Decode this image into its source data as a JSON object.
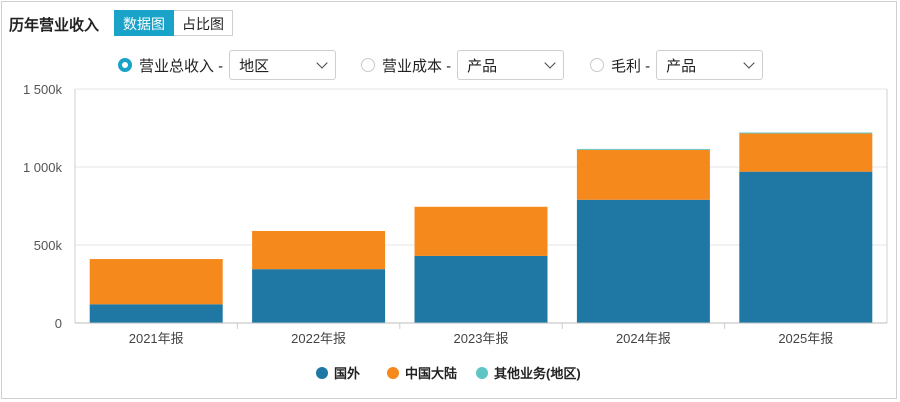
{
  "header": {
    "title": "历年营业收入",
    "tabs": [
      {
        "label": "数据图",
        "active": true
      },
      {
        "label": "占比图",
        "active": false
      }
    ]
  },
  "controls": [
    {
      "label": "营业总收入 -",
      "selected": true,
      "dropdown": "地区"
    },
    {
      "label": "营业成本 -",
      "selected": false,
      "dropdown": "产品"
    },
    {
      "label": "毛利 -",
      "selected": false,
      "dropdown": "产品"
    }
  ],
  "colors": {
    "accent": "#1aa3c9",
    "series": [
      "#1f77a4",
      "#f5891c",
      "#5ec4c4"
    ]
  },
  "icons": {
    "dropdown": "chevron-down-icon",
    "radio": "radio-icon",
    "legend": "legend-dot-icon"
  },
  "chart_data": {
    "type": "bar",
    "stacked": true,
    "categories": [
      "2021年报",
      "2022年报",
      "2023年报",
      "2024年报",
      "2025年报"
    ],
    "series": [
      {
        "name": "国外",
        "values": [
          120,
          345,
          430,
          790,
          970
        ]
      },
      {
        "name": "中国大陆",
        "values": [
          290,
          245,
          315,
          320,
          245
        ]
      },
      {
        "name": "其他业务(地区)",
        "values": [
          0,
          0,
          0,
          6,
          6
        ]
      }
    ],
    "yticks": [
      "0",
      "500k",
      "1 000k",
      "1 500k"
    ],
    "ylim": [
      0,
      1500
    ],
    "unit": "k",
    "grid": true,
    "legend_position": "bottom"
  }
}
